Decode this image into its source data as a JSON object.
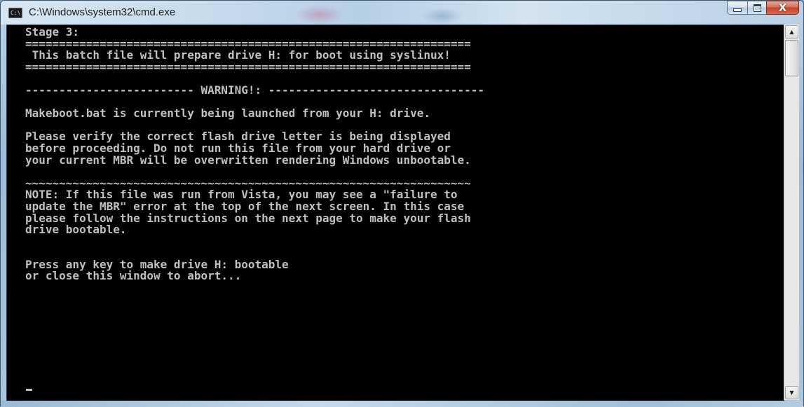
{
  "window": {
    "title": "C:\\Windows\\system32\\cmd.exe",
    "icon_label": "C:\\",
    "controls": {
      "minimize_icon": "minimize-icon",
      "maximize_icon": "maximize-icon",
      "close_icon": "close-icon",
      "close_glyph": "X"
    }
  },
  "console": {
    "text": "Stage 3:\n==================================================================\n This batch file will prepare drive H: for boot using syslinux!\n==================================================================\n\n------------------------- WARNING!: --------------------------------\n\nMakeboot.bat is currently being launched from your H: drive.\n\nPlease verify the correct flash drive letter is being displayed\nbefore proceeding. Do not run this file from your hard drive or\nyour current MBR will be overwritten rendering Windows unbootable.\n\n~~~~~~~~~~~~~~~~~~~~~~~~~~~~~~~~~~~~~~~~~~~~~~~~~~~~~~~~~~~~~~~~~~\nNOTE: If this file was run from Vista, you may see a \"failure to\nupdate the MBR\" error at the top of the next screen. In this case\nplease follow the instructions on the next page to make your flash\ndrive bootable.\n\n\nPress any key to make drive H: bootable\nor close this window to abort...",
    "text_color": "#c0c0c0",
    "background": "#000000"
  },
  "scrollbar": {
    "up_glyph": "▲",
    "down_glyph": "▼"
  }
}
